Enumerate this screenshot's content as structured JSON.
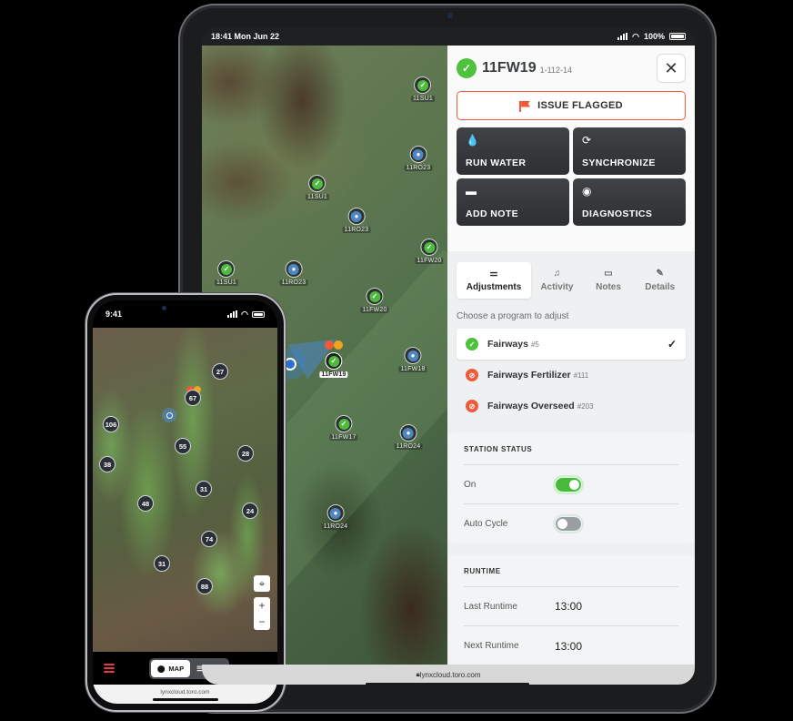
{
  "tablet": {
    "status": {
      "time_date": "18:41 Mon Jun 22",
      "battery": "100%"
    },
    "url": "lynxcloud.toro.com",
    "map_pins": [
      {
        "label": "11SU1",
        "type": "ok"
      },
      {
        "label": "11RO23",
        "type": "water"
      },
      {
        "label": "11SU1",
        "type": "ok"
      },
      {
        "label": "11RO23",
        "type": "water"
      },
      {
        "label": "11FW20",
        "type": "ok"
      },
      {
        "label": "11SU1",
        "type": "ok"
      },
      {
        "label": "11RO23",
        "type": "water"
      },
      {
        "label": "11FW20",
        "type": "ok"
      },
      {
        "label": "11FW18",
        "type": "water"
      },
      {
        "label": "11FW19",
        "type": "ok",
        "selected": true
      },
      {
        "label": "11FW17",
        "type": "ok"
      },
      {
        "label": "11RO24",
        "type": "water"
      },
      {
        "label": "11RO24",
        "type": "water"
      }
    ],
    "panel": {
      "station_name": "11FW19",
      "station_code": "1-112-14",
      "issue_label": "ISSUE FLAGGED",
      "actions": [
        {
          "label": "RUN WATER",
          "icon": "droplet-icon"
        },
        {
          "label": "SYNCHRONIZE",
          "icon": "sync-icon"
        },
        {
          "label": "ADD NOTE",
          "icon": "note-icon"
        },
        {
          "label": "DIAGNOSTICS",
          "icon": "signal-icon"
        }
      ],
      "tabs": [
        {
          "label": "Adjustments",
          "active": true
        },
        {
          "label": "Activity"
        },
        {
          "label": "Notes"
        },
        {
          "label": "Details"
        }
      ],
      "choose_label": "Choose a program to adjust",
      "programs": [
        {
          "name": "Fairways",
          "num": "#5",
          "status": "active",
          "selected": true
        },
        {
          "name": "Fairways Fertilizer",
          "num": "#111",
          "status": "disabled"
        },
        {
          "name": "Fairways Overseed",
          "num": "#203",
          "status": "disabled"
        }
      ],
      "station_status": {
        "title": "STATION STATUS",
        "rows": [
          {
            "label": "On",
            "value": true
          },
          {
            "label": "Auto Cycle",
            "value": false
          }
        ]
      },
      "runtime": {
        "title": "RUNTIME",
        "rows": [
          {
            "label": "Last Runtime",
            "value": "13:00"
          },
          {
            "label": "Next Runtime",
            "value": "13:00"
          }
        ]
      }
    }
  },
  "phone": {
    "status": {
      "time": "9:41"
    },
    "clusters": [
      "27",
      "67",
      "106",
      "55",
      "28",
      "38",
      "31",
      "48",
      "24",
      "74",
      "31",
      "88"
    ],
    "nav": {
      "map_label": "MAP",
      "list_label": "LIST",
      "more": "•••"
    },
    "url": "lynxcloud.toro.com"
  },
  "colors": {
    "accent_green": "#4fc23d",
    "flag_red": "#ef5a3a",
    "water_blue": "#4f86c2"
  }
}
